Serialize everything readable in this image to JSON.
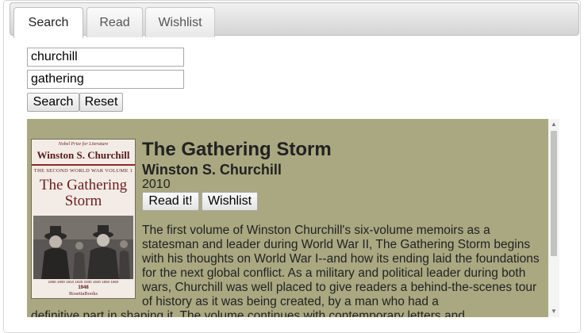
{
  "tabs": [
    {
      "label": "Search",
      "active": true
    },
    {
      "label": "Read",
      "active": false
    },
    {
      "label": "Wishlist",
      "active": false
    }
  ],
  "search": {
    "author_value": "churchill",
    "title_value": "gathering",
    "search_label": "Search",
    "reset_label": "Reset"
  },
  "result": {
    "title": "The Gathering Storm",
    "author": "Winston S. Churchill",
    "year": "2010",
    "read_label": "Read it!",
    "wishlist_label": "Wishlist",
    "description": "The first volume of Winston Churchill's six-volume memoirs as a statesman and leader during World War II, The Gathering Storm begins with his thoughts on World War I--and how its ending laid the foundations for the next global conflict. As a military and political leader during both wars, Churchill was well placed to give readers a behind-the-scenes tour of history as it was being created, by a man who had a",
    "description_cont": "definitive part in shaping it. The volume continues with contemporary letters and",
    "cover": {
      "prize": "Nobel Prize for Literature",
      "author": "Winston S. Churchill",
      "series": "THE SECOND WORLD WAR VOLUME 1",
      "title_line1": "The Gathering",
      "title_line2": "Storm",
      "timeline": "1890  1900  1910  1920  1930  1940  1950  1960",
      "year": "1948",
      "publisher": "RosettaBooks"
    }
  },
  "colors": {
    "result_bg": "#a9a881",
    "cover_title": "#6b1d1d"
  }
}
